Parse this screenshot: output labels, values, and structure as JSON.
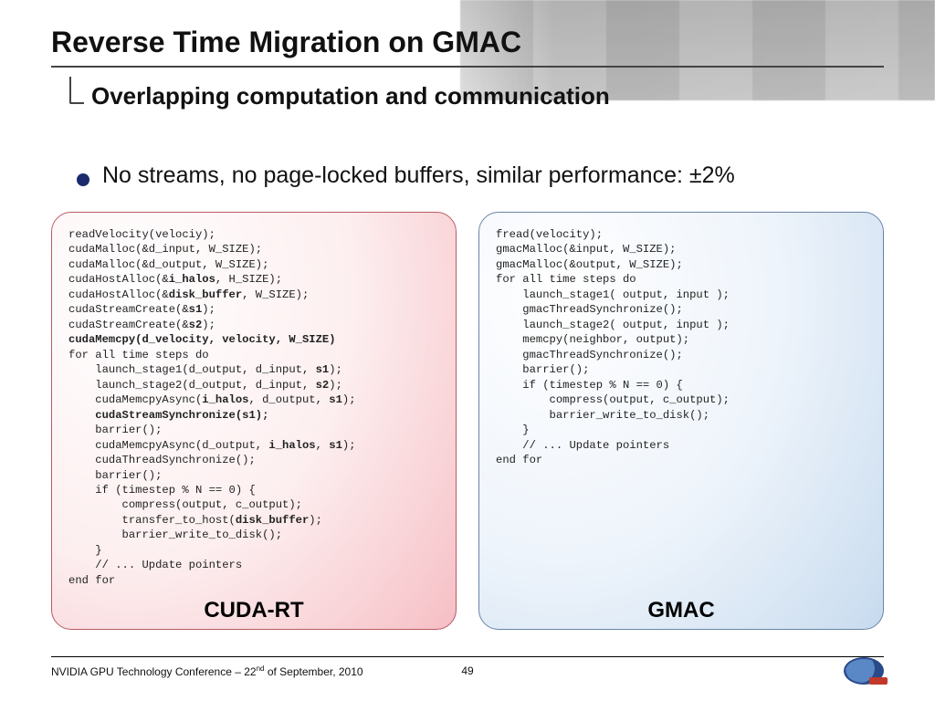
{
  "title": "Reverse Time Migration on GMAC",
  "subtitle": "Overlapping computation and communication",
  "bullet": "No streams, no page-locked buffers, similar performance: ±2%",
  "left": {
    "label": "CUDA-RT",
    "lines": [
      {
        "t": "readVelocity(velociy);"
      },
      {
        "t": "cudaMalloc(&d_input, W_SIZE);"
      },
      {
        "t": "cudaMalloc(&d_output, W_SIZE);"
      },
      {
        "t": "cudaHostAlloc(&",
        "b": "i_halos",
        "a": ", H_SIZE);"
      },
      {
        "t": "cudaHostAlloc(&",
        "b": "disk_buffer",
        "a": ", W_SIZE);"
      },
      {
        "t": "cudaStreamCreate(&",
        "b": "s1",
        "a": ");"
      },
      {
        "t": "cudaStreamCreate(&",
        "b": "s2",
        "a": ");"
      },
      {
        "b": "cudaMemcpy(d_velocity, velocity, W_SIZE)"
      },
      {
        "t": "for all time steps do"
      },
      {
        "t": "    launch_stage1(d_output, d_input, ",
        "b": "s1",
        "a": ");"
      },
      {
        "t": "    launch_stage2(d_output, d_input, ",
        "b": "s2",
        "a": ");"
      },
      {
        "t": "    cudaMemcpyAsync(",
        "b": "i_halos",
        "a": ", d_output, ",
        "b2": "s1",
        "a2": ");"
      },
      {
        "t": "    ",
        "b": "cudaStreamSynchronize(s1);"
      },
      {
        "t": "    barrier();"
      },
      {
        "t": "    cudaMemcpyAsync(d_output, ",
        "b": "i_halos",
        "a": ", ",
        "b2": "s1",
        "a2": ");"
      },
      {
        "t": "    cudaThreadSynchronize();"
      },
      {
        "t": "    barrier();"
      },
      {
        "t": "    if (timestep % N == 0) {"
      },
      {
        "t": "        compress(output, c_output);"
      },
      {
        "t": "        transfer_to_host(",
        "b": "disk_buffer",
        "a": ");"
      },
      {
        "t": "        barrier_write_to_disk();"
      },
      {
        "t": "    }"
      },
      {
        "t": "    // ... Update pointers"
      },
      {
        "t": "end for"
      }
    ]
  },
  "right": {
    "label": "GMAC",
    "lines": [
      {
        "t": "fread(velocity);"
      },
      {
        "t": "gmacMalloc(&input, W_SIZE);"
      },
      {
        "t": "gmacMalloc(&output, W_SIZE);"
      },
      {
        "t": ""
      },
      {
        "t": ""
      },
      {
        "t": ""
      },
      {
        "t": ""
      },
      {
        "t": ""
      },
      {
        "t": "for all time steps do"
      },
      {
        "t": "    launch_stage1( output, input );"
      },
      {
        "t": "    gmacThreadSynchronize();"
      },
      {
        "t": "    launch_stage2( output, input );"
      },
      {
        "t": ""
      },
      {
        "t": ""
      },
      {
        "t": "    memcpy(neighbor, output);"
      },
      {
        "t": "    gmacThreadSynchronize();"
      },
      {
        "t": "    barrier();"
      },
      {
        "t": "    if (timestep % N == 0) {"
      },
      {
        "t": "        compress(output, c_output);"
      },
      {
        "t": ""
      },
      {
        "t": "        barrier_write_to_disk();"
      },
      {
        "t": "    }"
      },
      {
        "t": "    // ... Update pointers"
      },
      {
        "t": "end for"
      }
    ]
  },
  "footer": {
    "conference_prefix": "NVIDIA GPU Technology Conference – 22",
    "conference_sup": "nd",
    "conference_suffix": " of September, 2010",
    "page": "49"
  }
}
